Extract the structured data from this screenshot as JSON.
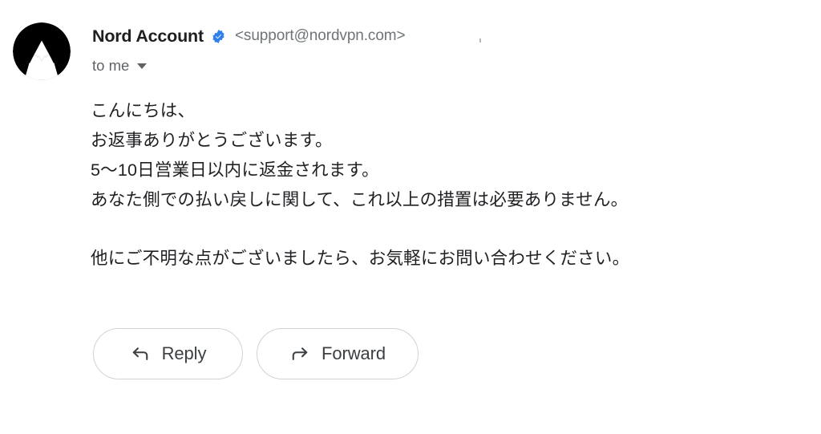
{
  "message": {
    "avatar": {
      "icon": "nordvpn-mountain-logo",
      "background_color": "#000000",
      "foreground_color": "#ffffff"
    },
    "sender": {
      "name": "Nord Account",
      "verified_badge_icon": "verified-check-badge",
      "verified_badge_color": "#2f80ed",
      "email": "<support@nordvpn.com>"
    },
    "recipient": {
      "label": "to me",
      "expand_icon": "chevron-down-icon"
    },
    "body": {
      "paragraphs": [
        {
          "lines": [
            "こんにちは、",
            "お返事ありがとうございます。",
            "5〜10日営業日以内に返金されます。",
            "あなた側での払い戻しに関して、これ以上の措置は必要ありません。"
          ]
        },
        {
          "lines": [
            "他にご不明な点がございましたら、お気軽にお問い合わせください。"
          ]
        }
      ]
    },
    "actions": [
      {
        "label": "Reply",
        "icon": "reply-arrow-icon"
      },
      {
        "label": "Forward",
        "icon": "forward-arrow-icon"
      }
    ]
  },
  "colors": {
    "page_background": "#ffffff",
    "sender_name": "#1f1f1f",
    "sender_email": "#6e7478",
    "body_text": "#202124",
    "button_border": "#cfd3d6",
    "button_label": "#3c4043"
  }
}
